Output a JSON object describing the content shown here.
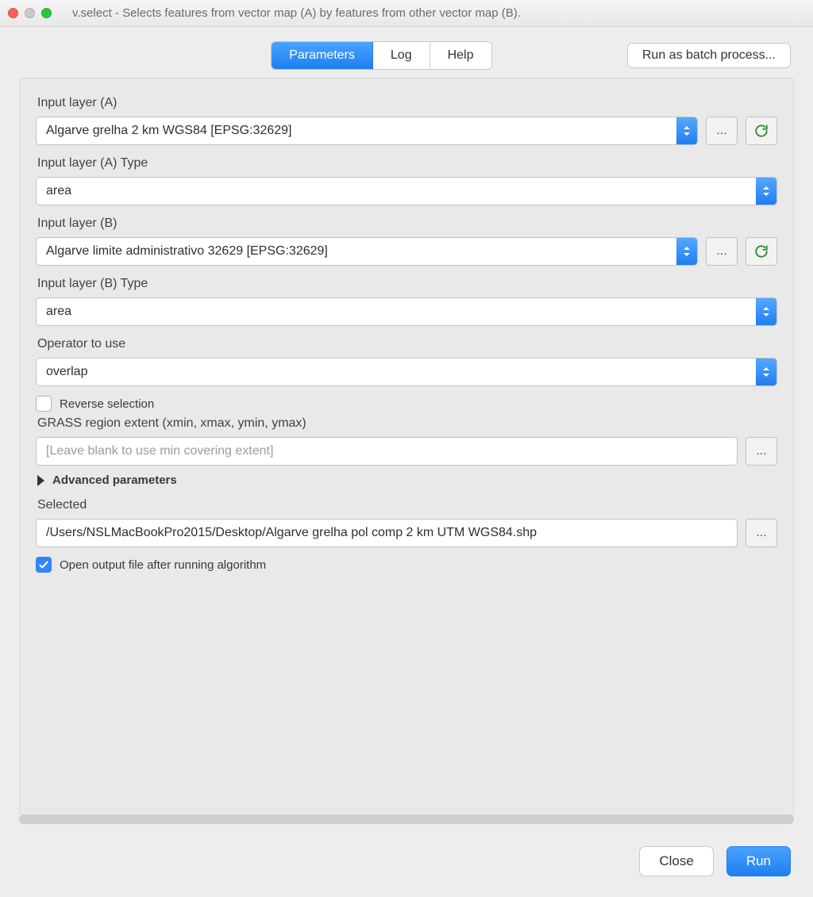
{
  "window": {
    "title": "v.select - Selects features from vector map (A) by features from other vector map (B)."
  },
  "tabs": {
    "parameters": "Parameters",
    "log": "Log",
    "help": "Help"
  },
  "batch_button": "Run as batch process...",
  "form": {
    "input_a_label": "Input layer (A)",
    "input_a_value": "Algarve grelha 2 km WGS84 [EPSG:32629]",
    "input_a_type_label": "Input layer (A) Type",
    "input_a_type_value": "area",
    "input_b_label": "Input layer (B)",
    "input_b_value": "Algarve limite administrativo 32629 [EPSG:32629]",
    "input_b_type_label": "Input layer (B) Type",
    "input_b_type_value": "area",
    "operator_label": "Operator to use",
    "operator_value": "overlap",
    "reverse_label": "Reverse selection",
    "extent_label": "GRASS region extent (xmin, xmax, ymin, ymax)",
    "extent_placeholder": "[Leave blank to use min covering extent]",
    "advanced_label": "Advanced parameters",
    "selected_label": "Selected",
    "selected_value": "/Users/NSLMacBookPro2015/Desktop/Algarve grelha pol comp 2 km UTM WGS84.shp",
    "open_after_label": "Open output file after running algorithm"
  },
  "footer": {
    "close": "Close",
    "run": "Run"
  },
  "icons": {
    "ellipsis": "...",
    "iterate": "iterate-icon"
  }
}
